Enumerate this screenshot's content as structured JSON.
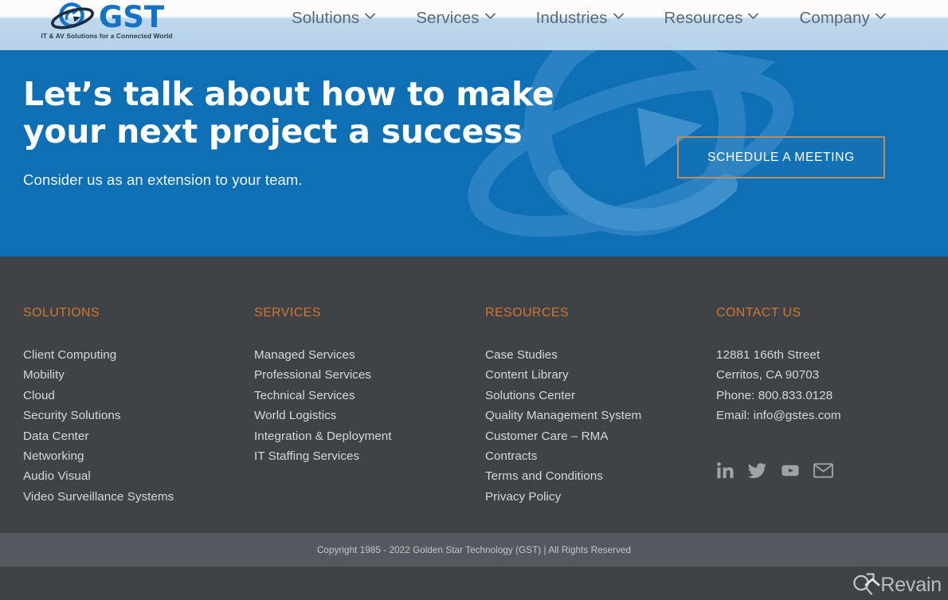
{
  "header": {
    "logo": {
      "mark_icon": "gst-orbit-swoosh-icon",
      "wordmark": "GST",
      "tagline": "IT & AV Solutions for a Connected World"
    },
    "nav": [
      {
        "label": "Solutions",
        "icon": "chevron-down-icon"
      },
      {
        "label": "Services",
        "icon": "chevron-down-icon"
      },
      {
        "label": "Industries",
        "icon": "chevron-down-icon"
      },
      {
        "label": "Resources",
        "icon": "chevron-down-icon"
      },
      {
        "label": "Company",
        "icon": "chevron-down-icon"
      }
    ]
  },
  "hero": {
    "title": "Let’s talk about how to make your next project a success",
    "subtitle": "Consider us as an extension to your team.",
    "cta_label": "SCHEDULE A MEETING",
    "background_icon": "gst-orbit-swoosh-watermark-icon",
    "bg_color": "#0f6fb5",
    "cta_border_color": "#c08e52"
  },
  "footer": {
    "accent_color": "#d4762a",
    "bg_color": "#3f4347",
    "columns": [
      {
        "heading": "SOLUTIONS",
        "links": [
          "Client Computing",
          "Mobility",
          "Cloud",
          "Security Solutions",
          "Data Center",
          "Networking",
          "Audio Visual",
          "Video Surveillance Systems"
        ]
      },
      {
        "heading": "SERVICES",
        "links": [
          "Managed Services",
          "Professional Services",
          "Technical Services",
          "World Logistics",
          "Integration & Deployment",
          "IT Staffing Services"
        ]
      },
      {
        "heading": "RESOURCES",
        "links": [
          "Case Studies",
          "Content Library",
          "Solutions Center",
          "Quality Management System",
          "Customer Care – RMA",
          "Contracts",
          "Terms and Conditions",
          "Privacy Policy"
        ]
      },
      {
        "heading": "CONTACT US",
        "lines": [
          "12881 166th Street",
          "Cerritos, CA 90703",
          "Phone: 800.833.0128",
          "Email: info@gstes.com"
        ],
        "socials": [
          {
            "name": "linkedin-icon"
          },
          {
            "name": "twitter-icon"
          },
          {
            "name": "youtube-icon"
          },
          {
            "name": "email-icon"
          }
        ]
      }
    ],
    "copyright": "Copyright 1985 - 2022 Golden Star Technology (GST) | All Rights Reserved"
  },
  "overlay": {
    "watermark_text": "Revain",
    "watermark_icon": "revain-logo-icon",
    "scroll_top_icon": "chevron-up-icon"
  }
}
